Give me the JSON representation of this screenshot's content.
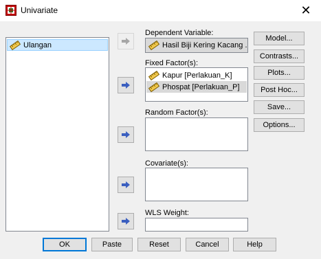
{
  "window": {
    "title": "Univariate",
    "close_glyph": "✕"
  },
  "source_list": {
    "items": [
      {
        "label": "Ulangan",
        "icon": "scale-ruler-icon",
        "selected": true
      }
    ]
  },
  "dependent": {
    "label": "Dependent Variable:",
    "value": "Hasil Biji Kering Kacang ..."
  },
  "fixed_factors": {
    "label": "Fixed Factor(s):",
    "items": [
      {
        "label": "Kapur [Perlakuan_K]",
        "icon": "scale-ruler-icon"
      },
      {
        "label": "Phospat [Perlakuan_P]",
        "icon": "scale-ruler-icon"
      }
    ]
  },
  "random_factors": {
    "label": "Random Factor(s):"
  },
  "covariates": {
    "label": "Covariate(s):"
  },
  "wls": {
    "label": "WLS Weight:"
  },
  "side_buttons": {
    "model": "Model...",
    "contrasts": "Contrasts...",
    "plots": "Plots...",
    "post_hoc": "Post Hoc...",
    "save": "Save...",
    "options": "Options..."
  },
  "bottom_buttons": {
    "ok": "OK",
    "paste": "Paste",
    "reset": "Reset",
    "cancel": "Cancel",
    "help": "Help"
  },
  "colors": {
    "arrow": "#3b5fc0",
    "selected": "#cce8ff",
    "default_border": "#0078d7"
  }
}
